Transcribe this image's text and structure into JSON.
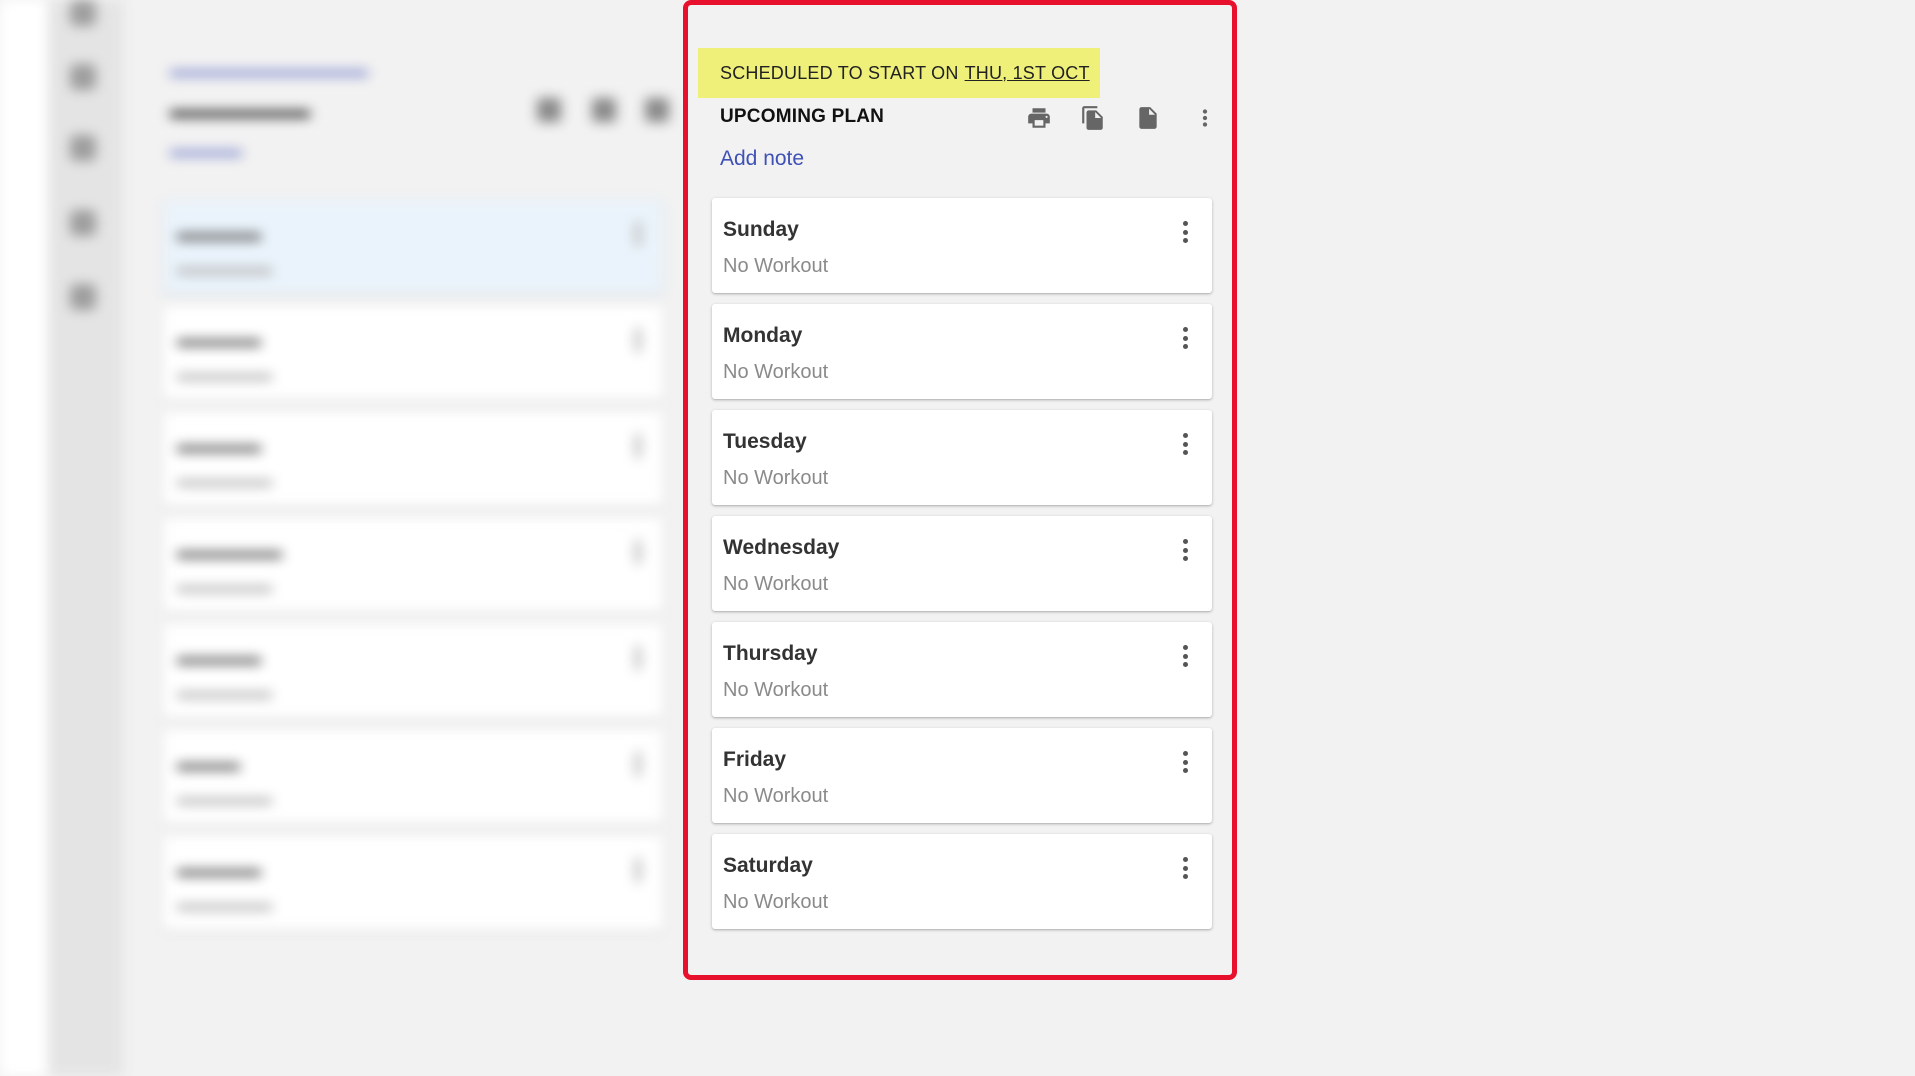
{
  "schedule": {
    "prefix": "SCHEDULED TO START ON",
    "date": "THU, 1ST OCT"
  },
  "plan": {
    "title": "UPCOMING PLAN",
    "add_note_label": "Add note"
  },
  "toolbar": {
    "icons": [
      "print-icon",
      "copy-icon",
      "document-icon",
      "more-vert-icon"
    ]
  },
  "days": [
    {
      "name": "Sunday",
      "status": "No Workout"
    },
    {
      "name": "Monday",
      "status": "No Workout"
    },
    {
      "name": "Tuesday",
      "status": "No Workout"
    },
    {
      "name": "Wednesday",
      "status": "No Workout"
    },
    {
      "name": "Thursday",
      "status": "No Workout"
    },
    {
      "name": "Friday",
      "status": "No Workout"
    },
    {
      "name": "Saturday",
      "status": "No Workout"
    }
  ],
  "colors": {
    "highlight_border": "#e8112d",
    "banner_background": "#eff07a",
    "link": "#3f51b5"
  }
}
